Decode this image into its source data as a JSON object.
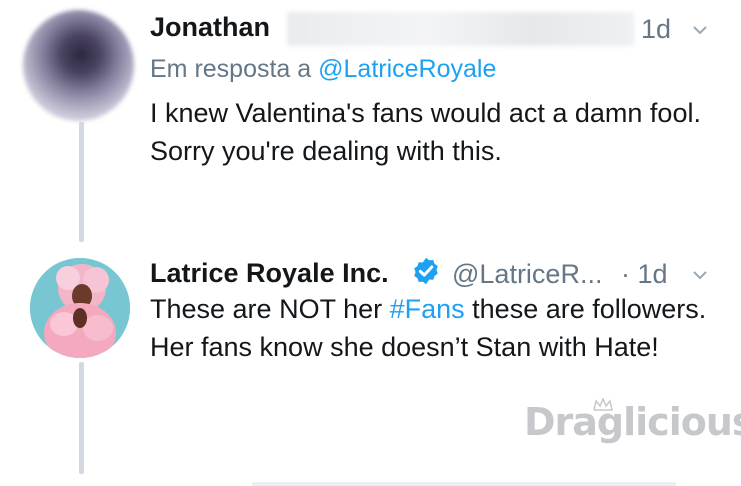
{
  "tweets": [
    {
      "name": "Jonathan",
      "time": "1d",
      "reply_prefix": "Em resposta a ",
      "reply_mention": "@LatriceRoyale",
      "text": "I knew Valentina's fans would act a damn fool. Sorry you're dealing with this."
    },
    {
      "name": "Latrice Royale Inc.",
      "verified": true,
      "handle": "@LatriceR...",
      "time": "· 1d",
      "text_before": "These are NOT her ",
      "hashtag": "#Fans",
      "text_after": " these are followers. Her fans know she doesn’t Stan with Hate!"
    }
  ],
  "watermark": "Draglicious",
  "colors": {
    "link": "#1da1f2",
    "muted": "#657786",
    "text": "#14171a",
    "thread_line": "#d3d9de",
    "verified": "#1da1f2"
  },
  "icons": {
    "chevron": "chevron-down-icon",
    "verified": "verified-badge-icon"
  }
}
